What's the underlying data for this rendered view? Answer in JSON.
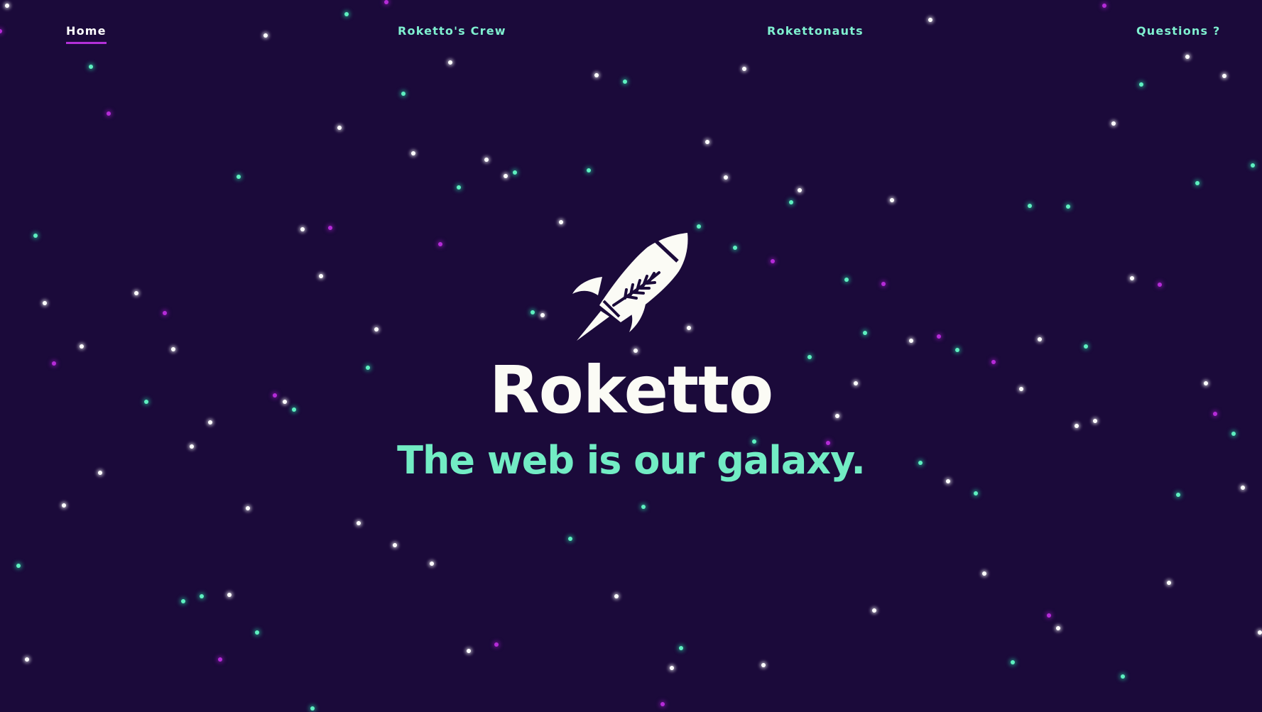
{
  "nav": {
    "items": [
      {
        "label": "Home",
        "active": true
      },
      {
        "label": "Roketto's Crew",
        "active": false
      },
      {
        "label": "Rokettonauts",
        "active": false
      },
      {
        "label": "Questions ?",
        "active": false
      }
    ]
  },
  "hero": {
    "logo_icon": "rocket-icon",
    "title": "Roketto",
    "tagline": "The web is our galaxy."
  },
  "colors": {
    "background": "#1b0a3a",
    "accent_teal": "#72ecc4",
    "accent_magenta": "#b230d8",
    "text_light": "#fbfbf5"
  }
}
